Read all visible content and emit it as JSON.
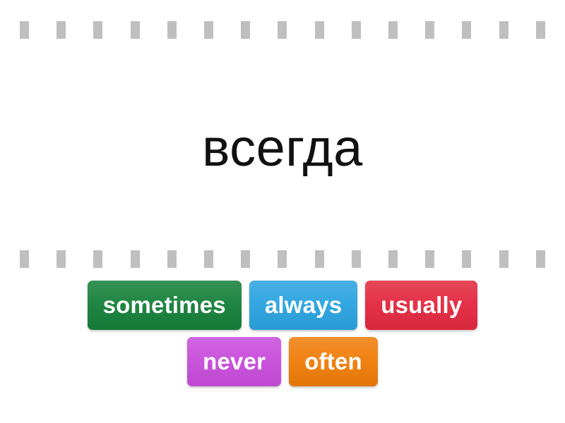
{
  "activity": {
    "type": "find-the-match",
    "prompt_word": "всегда",
    "background_color": "#ffffff",
    "text_color": "#111111"
  },
  "dividers": {
    "dash_color": "#bfbfbf",
    "dash_count": 15,
    "top": {
      "dashes": [
        "-",
        "-",
        "-",
        "-",
        "-",
        "-",
        "-",
        "-",
        "-",
        "-",
        "-",
        "-",
        "-",
        "-",
        "-"
      ]
    },
    "bottom": {
      "dashes": [
        "-",
        "-",
        "-",
        "-",
        "-",
        "-",
        "-",
        "-",
        "-",
        "-",
        "-",
        "-",
        "-",
        "-",
        "-"
      ]
    }
  },
  "answers": {
    "rows": [
      {
        "tiles": [
          {
            "label": "sometimes",
            "color": "#16803a"
          },
          {
            "label": "always",
            "color": "#2ba3e0"
          },
          {
            "label": "usually",
            "color": "#e32941"
          }
        ]
      },
      {
        "tiles": [
          {
            "label": "never",
            "color": "#c84ddb"
          },
          {
            "label": "often",
            "color": "#f07d0a"
          }
        ]
      }
    ]
  }
}
